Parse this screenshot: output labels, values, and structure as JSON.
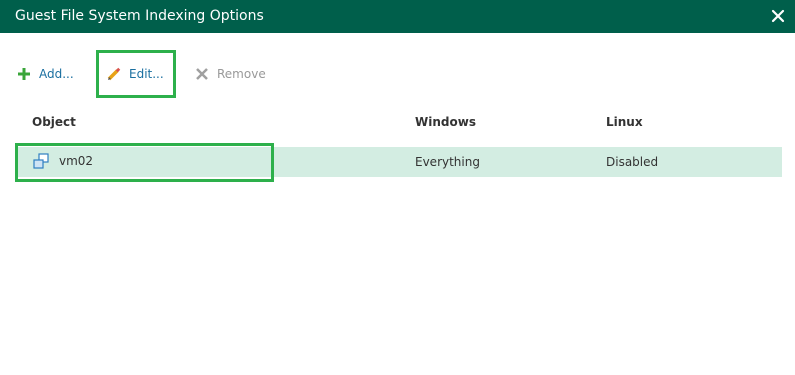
{
  "window": {
    "title": "Guest File System Indexing Options"
  },
  "toolbar": {
    "add_label": "Add...",
    "edit_label": "Edit...",
    "remove_label": "Remove"
  },
  "table": {
    "columns": [
      "Object",
      "Windows",
      "Linux"
    ],
    "rows": [
      {
        "object": "vm02",
        "windows": "Everything",
        "linux": "Disabled",
        "selected": true
      }
    ]
  },
  "colors": {
    "titlebar": "#005f4b",
    "highlight_border": "#2db04b",
    "selected_row": "#d3ede2",
    "link": "#1a6fa0"
  },
  "icons": {
    "close": "close-icon",
    "add": "plus-icon",
    "edit": "pencil-icon",
    "remove": "x-icon",
    "vm": "vm-icon"
  }
}
